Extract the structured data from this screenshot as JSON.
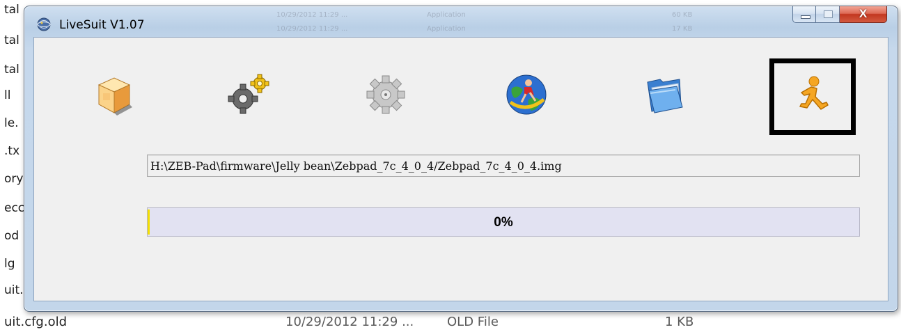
{
  "background": {
    "left_items": [
      "tal",
      "tal",
      "tal",
      "ll",
      "le.",
      ".tx",
      "ory",
      "ecc",
      "od",
      "lg",
      "uit."
    ],
    "blurred_rows": [
      [
        "10/29/2012 11:29 ...",
        "Application",
        "60 KB"
      ],
      [
        "10/29/2012 11:29 ...",
        "Application",
        "17 KB"
      ]
    ],
    "bottom_row": {
      "name": "uit.cfg.old",
      "date": "10/29/2012 11:29 ...",
      "type": "OLD File",
      "size": "1 KB"
    }
  },
  "window": {
    "title": "LiveSuit V1.07",
    "caption": {
      "close_glyph": "X"
    }
  },
  "toolbar": {
    "tools": [
      {
        "icon": "package-box-icon"
      },
      {
        "icon": "gear-settings-icon"
      },
      {
        "icon": "gray-gear-icon"
      },
      {
        "icon": "globe-runner-icon"
      },
      {
        "icon": "blue-folder-icon"
      },
      {
        "icon": "running-person-icon",
        "selected": true
      }
    ]
  },
  "image_path": "H:\\ZEB-Pad\\firmware\\Jelly bean\\Zebpad_7c_4_0_4/Zebpad_7c_4_0_4.img",
  "progress": {
    "value": 0,
    "label": "0%"
  },
  "colors": {
    "frame": "#c3d6ea",
    "client": "#f0f0f0",
    "progress_track": "#e2e2f2",
    "progress_edge": "#f4e000",
    "close": "#c2371f"
  }
}
